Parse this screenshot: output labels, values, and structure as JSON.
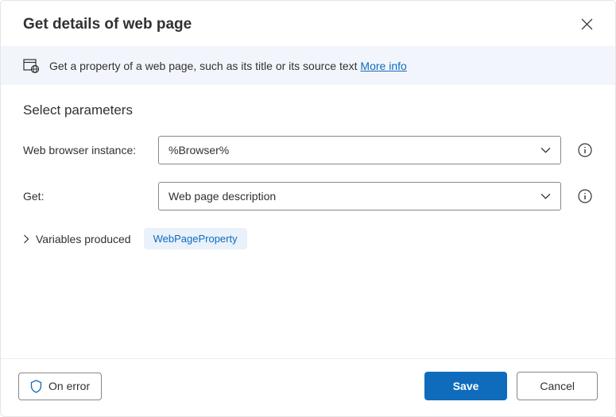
{
  "header": {
    "title": "Get details of web page"
  },
  "info_bar": {
    "description": "Get a property of a web page, such as its title or its source text ",
    "more_info_label": "More info"
  },
  "content": {
    "section_title": "Select parameters",
    "fields": {
      "browser": {
        "label": "Web browser instance:",
        "value": "%Browser%"
      },
      "get": {
        "label": "Get:",
        "value": "Web page description"
      }
    },
    "variables": {
      "label": "Variables produced",
      "pill": "WebPageProperty"
    }
  },
  "footer": {
    "on_error": "On error",
    "save": "Save",
    "cancel": "Cancel"
  }
}
